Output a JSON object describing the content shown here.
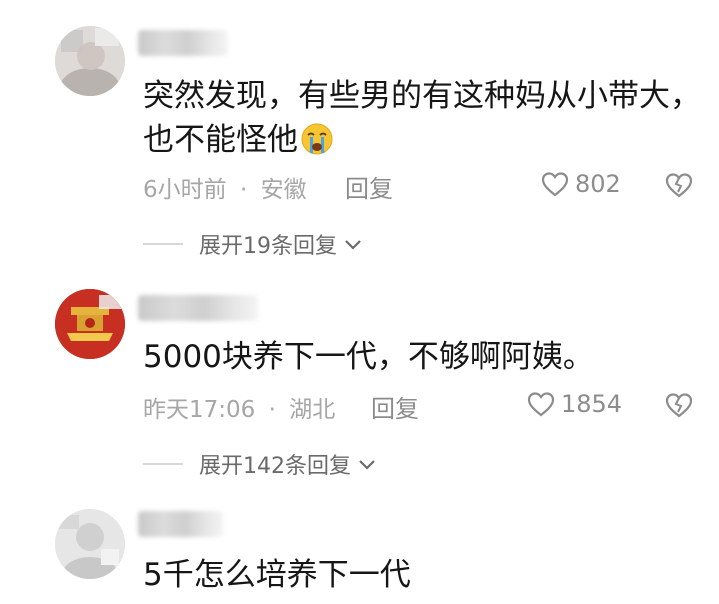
{
  "comments": [
    {
      "text_line1": "突然发现，有些男的有这种妈从小带大，",
      "text_line2": "也不能怪他",
      "emoji": "crying-face-emoji",
      "time": "6小时前",
      "separator": "·",
      "location": "安徽",
      "reply_label": "回复",
      "likes": "802",
      "expand_label": "展开19条回复"
    },
    {
      "text_line1": "5000块养下一代，不够啊阿姨。",
      "time": "昨天17:06",
      "separator": "·",
      "location": "湖北",
      "reply_label": "回复",
      "likes": "1854",
      "expand_label": "展开142条回复"
    },
    {
      "text_line1": "5千怎么培养下一代"
    }
  ],
  "colors": {
    "text": "#161616",
    "meta": "#a6a6a6",
    "icon": "#8c8c8c",
    "avatar2_red": "#c62f22",
    "emoji_yellow": "#f7c531",
    "tear_blue": "#4aa3e8"
  }
}
